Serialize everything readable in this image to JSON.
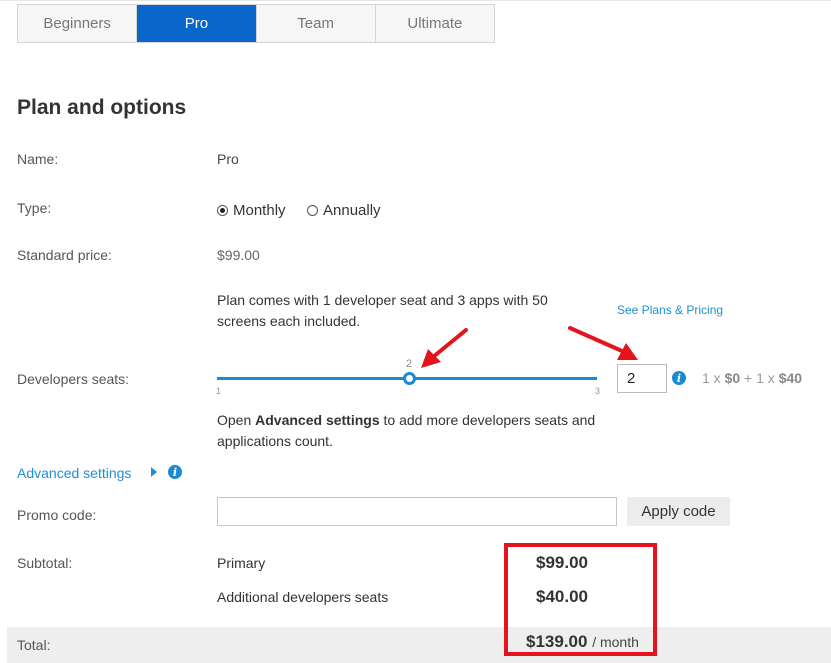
{
  "tabs": [
    {
      "label": "Beginners",
      "active": false
    },
    {
      "label": "Pro",
      "active": true
    },
    {
      "label": "Team",
      "active": false
    },
    {
      "label": "Ultimate",
      "active": false
    }
  ],
  "section_title": "Plan and options",
  "name": {
    "label": "Name:",
    "value": "Pro"
  },
  "type": {
    "label": "Type:",
    "options": [
      {
        "label": "Monthly",
        "selected": true
      },
      {
        "label": "Annually",
        "selected": false
      }
    ]
  },
  "standard_price": {
    "label": "Standard price:",
    "value": "$99.00"
  },
  "plan_note": {
    "line1": "Plan comes with 1 developer seat and 3 apps with 50",
    "line2": "screens each included."
  },
  "see_plans_link": "See Plans & Pricing",
  "developers_seats": {
    "label": "Developers seats:",
    "slider": {
      "min": "1",
      "max": "3",
      "value": 2,
      "value_label": "2"
    },
    "input_value": "2",
    "formula": {
      "prefix1": "1 x ",
      "price1": "$0",
      "plus": " + 1 x ",
      "price2": "$40"
    }
  },
  "advanced_note": {
    "pre": "Open ",
    "bold": "Advanced settings",
    "post": " to add more developers seats and",
    "line2": "applications count."
  },
  "advanced_settings_link": "Advanced settings",
  "promo": {
    "label": "Promo code:",
    "value": "",
    "button": "Apply code"
  },
  "subtotal": {
    "label": "Subtotal:",
    "items": [
      {
        "label": "Primary",
        "amount": "$99.00"
      },
      {
        "label": "Additional developers seats",
        "amount": "$40.00"
      }
    ]
  },
  "total": {
    "label": "Total:",
    "amount": "$139.00",
    "period": "/ month"
  },
  "colors": {
    "accent": "#0a66c9",
    "link": "#1d8fd6",
    "annotation": "#e5131d"
  },
  "icons": [
    "info-icon",
    "chevron-right-icon",
    "red-arrow-annotation"
  ]
}
